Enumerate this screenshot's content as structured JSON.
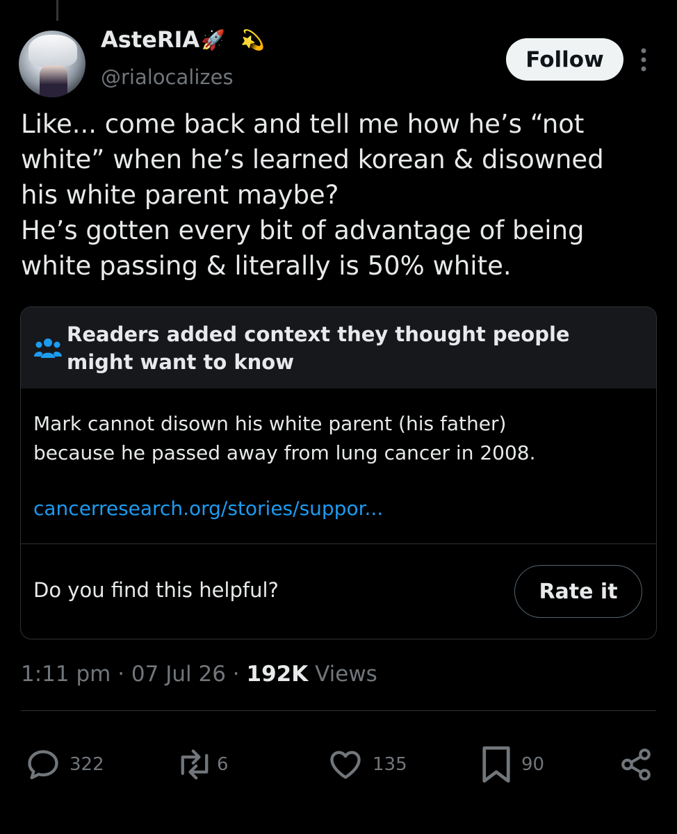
{
  "author": {
    "display_name": "AsteRIA",
    "emoji_1": "🚀",
    "emoji_2": "💫",
    "handle": "@rialocalizes",
    "avatar_icon": "avatar-image"
  },
  "follow_label": "Follow",
  "tweet": {
    "text": "Like... come back and tell me how he’s “not\nwhite” when he’s learned korean & disowned\nhis white parent maybe?\nHe’s gotten every bit of advantage of being\nwhite passing & literally is 50% white."
  },
  "community_note": {
    "title": "Readers added context they thought people might want to know",
    "icon": "people-icon",
    "body": "Mark cannot disown his white parent (his father)\nbecause he passed away from lung cancer in 2008.",
    "link": "cancerresearch.org/stories/suppor...",
    "helpful_question": "Do you find this helpful?",
    "rate_label": "Rate it"
  },
  "meta": {
    "time": "1:11 pm",
    "date": "07 Jul 26",
    "separator": "·",
    "views_count": "192K",
    "views_label": "Views"
  },
  "actions": {
    "replies": "322",
    "reposts": "6",
    "likes": "135",
    "bookmarks": "90"
  },
  "colors": {
    "background": "#000000",
    "text": "#e7e9ea",
    "secondary": "#71767b",
    "link": "#1d9bf0",
    "note_header": "#16181c",
    "border": "#2f3336"
  }
}
